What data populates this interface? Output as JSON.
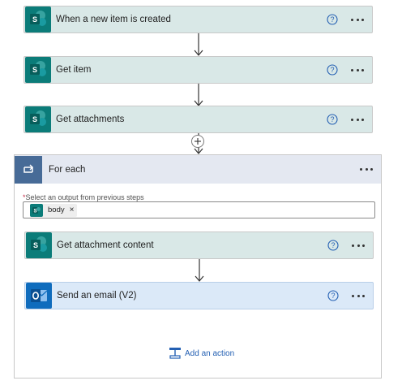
{
  "steps": [
    {
      "title": "When a new item is created",
      "icon": "sharepoint-icon"
    },
    {
      "title": "Get item",
      "icon": "sharepoint-icon"
    },
    {
      "title": "Get attachments",
      "icon": "sharepoint-icon"
    }
  ],
  "foreach": {
    "title": "For each",
    "icon": "loop-icon",
    "field_label": "Select an output from previous steps",
    "required_marker": "*",
    "token_label": "body",
    "token_remove": "×",
    "inner_steps": [
      {
        "title": "Get attachment content",
        "icon": "sharepoint-icon"
      },
      {
        "title": "Send an email (V2)",
        "icon": "outlook-icon"
      }
    ],
    "add_action_label": "Add an action"
  },
  "colors": {
    "sharepoint": "#0b7c79",
    "outlook": "#0f6cbd",
    "loop": "#476b97",
    "link": "#2460b3"
  }
}
